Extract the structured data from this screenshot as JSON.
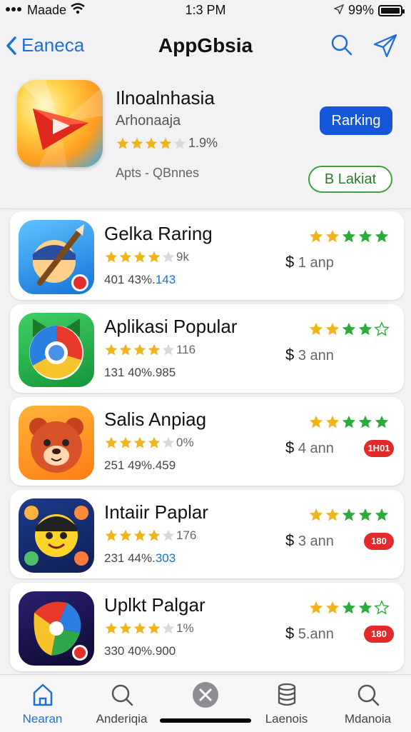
{
  "status": {
    "carrier": "Maade",
    "time": "1:3 PM",
    "battery": "99%",
    "battery_level": 0.99
  },
  "nav": {
    "back_label": "Eaneca",
    "title": "AppGbsia"
  },
  "featured": {
    "name": "Ilnoalnhasia",
    "subtitle": "Arhonaaja",
    "rating": 3.5,
    "rating_text": "1.9%",
    "category": "Apts - QBnnes",
    "rank_button": "Rarking",
    "secondary_button": "B Lakiat"
  },
  "apps": [
    {
      "name": "Gelka Raring",
      "rating": 4,
      "rating_text": "9k",
      "meta": "401 43%.",
      "meta_hl": "143",
      "price_symbol": "$",
      "price": "1 anp",
      "right_rating": 5,
      "badge": ""
    },
    {
      "name": "Aplikasi Popular",
      "rating": 4,
      "rating_text": "116",
      "meta": "131 40%.",
      "meta_hl": "",
      "meta_rest": "985",
      "price_symbol": "$",
      "price": "3 ann",
      "right_rating": 4,
      "badge": ""
    },
    {
      "name": "Salis Anpiag",
      "rating": 4,
      "rating_text": "0%",
      "meta": "251 49%.",
      "meta_hl": "",
      "meta_rest": "459",
      "price_symbol": "$",
      "price": "4 ann",
      "right_rating": 5,
      "badge": "1H01"
    },
    {
      "name": "Intaiir Paplar",
      "rating": 4,
      "rating_text": "176",
      "meta": "231 44%.",
      "meta_hl": "303",
      "price_symbol": "$",
      "price": "3 ann",
      "right_rating": 5,
      "badge": "180"
    },
    {
      "name": "Uplkt Palgar",
      "rating": 4,
      "rating_text": "1%",
      "meta": "330 40%.",
      "meta_hl": "",
      "meta_rest": "900",
      "price_symbol": "$",
      "price": "5.ann",
      "right_rating": 4,
      "badge": "180"
    }
  ],
  "tabs": [
    {
      "label": "Nearan",
      "icon": "home-icon",
      "active": true
    },
    {
      "label": "Anderiqia",
      "icon": "search-icon",
      "active": false
    },
    {
      "label": "",
      "icon": "close-circle-icon",
      "active": false
    },
    {
      "label": "Laenois",
      "icon": "storage-icon",
      "active": false
    },
    {
      "label": "Mdanoia",
      "icon": "search-icon",
      "active": false
    }
  ],
  "colors": {
    "accent": "#1f6fd6",
    "star_gold": "#f0b41c",
    "star_green": "#2bab3a",
    "badge_red": "#e32a2a"
  }
}
